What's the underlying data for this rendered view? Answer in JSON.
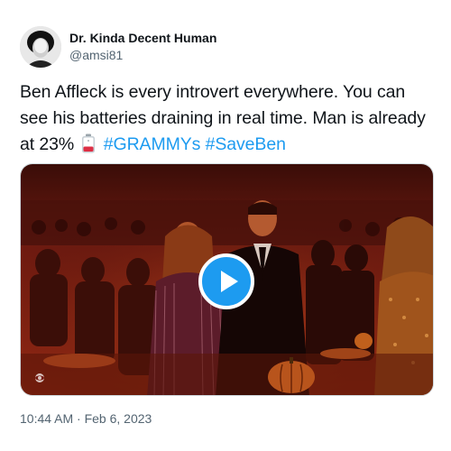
{
  "author": {
    "display_name": "Dr. Kinda Decent Human",
    "handle": "@amsi81"
  },
  "tweet": {
    "text_line": "Ben Affleck is every introvert everywhere. You can see his batteries draining in real time. Man is already at 23%",
    "hashtags": [
      "#GRAMMYs",
      "#SaveBen"
    ],
    "emoji": "battery-low-icon",
    "timestamp": "10:44 AM · Feb 6, 2023"
  },
  "media": {
    "type": "video",
    "play_icon": "play-icon"
  },
  "colors": {
    "link": "#1d9bf0",
    "text": "#0f1419",
    "secondary": "#536471",
    "scene_red": "#7a1a12"
  }
}
